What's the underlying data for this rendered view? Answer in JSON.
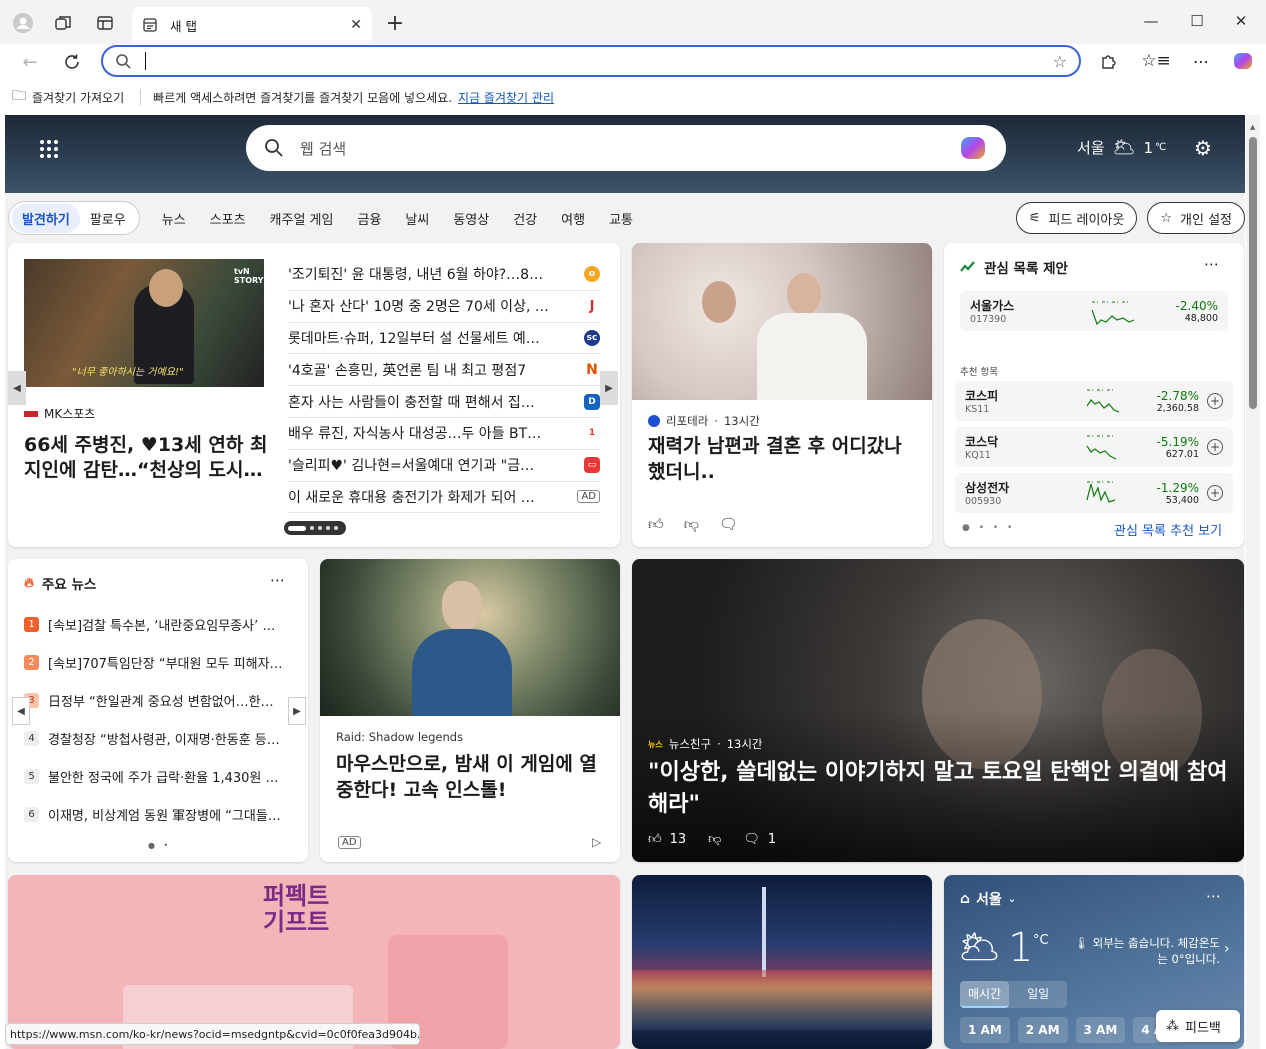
{
  "browser": {
    "tab_title": "새 탭",
    "favorites_import": "즐겨찾기 가져오기",
    "favorites_hint": "빠르게 액세스하려면 즐겨찾기를 즐겨찾기 모음에 넣으세요.",
    "favorites_manage": "지금 즐겨찾기 관리",
    "status_url": "https://www.msn.com/ko-kr/news?ocid=msedgntp&cvid=0c0f0fea3d904b...",
    "accent_color": "#3a63d8"
  },
  "hero": {
    "search_placeholder": "웹 검색",
    "city": "서울",
    "temp": "1",
    "temp_unit": "℃"
  },
  "nav": {
    "tabs": [
      "발견하기",
      "팔로우"
    ],
    "categories": [
      "뉴스",
      "스포츠",
      "캐주얼 게임",
      "금융",
      "날씨",
      "동영상",
      "건강",
      "여행",
      "교통"
    ],
    "feed_layout": "피드 레이아웃",
    "personalize": "개인 설정"
  },
  "carousel": {
    "source": "MK스포츠",
    "title": "66세 주병진, ♥13세 연하 최 지인에 감탄…“천상의 도시…",
    "image_caption": "\"너무 좋아하시는 거예요!\"",
    "image_logo": "tvN STORY",
    "headlines": [
      {
        "text": "'조기퇴진' 윤 대통령, 내년 6월 하야?…8…",
        "badge": "o",
        "badge_color": "#f5a623"
      },
      {
        "text": "'나 혼자 산다' 10명 중 2명은 70세 이상, …",
        "badge": "J",
        "badge_color": "#d32f2f"
      },
      {
        "text": "롯데마트·슈퍼, 12일부터 설 선물세트 예…",
        "badge": "sc",
        "badge_color": "#1e3a8a"
      },
      {
        "text": "'4호골' 손흥민, 英언론 팀 내 최고 평점7",
        "badge": "N",
        "badge_color": "#e65100"
      },
      {
        "text": "혼자 사는 사람들이 충전할 때 편해서 집…",
        "badge": "D",
        "badge_color": "#1565c0"
      },
      {
        "text": "배우 류진, 자식농사 대성공…두 아들 BT…",
        "badge": "1",
        "badge_color": "#e53935"
      },
      {
        "text": "'슬리피♥' 김나현=서울예대 연기과 \"금…",
        "badge": "▭",
        "badge_color": "#e53935"
      },
      {
        "text": "이 새로운 휴대용 충전기가 화제가 되어 …",
        "badge": "AD",
        "badge_color": "#ffffff"
      }
    ]
  },
  "feature": {
    "source": "리포테라",
    "age": "13시간",
    "title": "재력가 남편과 결혼 후 어디갔나 했더니.."
  },
  "watchlist": {
    "title": "관심 목록 제안",
    "stocks": [
      {
        "name": "서울가스",
        "code": "017390",
        "change": "-2.40%",
        "price": "48,800"
      }
    ],
    "recommended_label": "추천 항목",
    "recommended": [
      {
        "name": "코스피",
        "code": "KS11",
        "change": "-2.78%",
        "price": "2,360.58"
      },
      {
        "name": "코스닥",
        "code": "KQ11",
        "change": "-5.19%",
        "price": "627.01"
      },
      {
        "name": "삼성전자",
        "code": "005930",
        "change": "-1.29%",
        "price": "53,400"
      }
    ],
    "link": "관심 목록 추천 보기"
  },
  "top_news": {
    "title": "주요 뉴스",
    "items": [
      {
        "n": "1",
        "text": "[속보]검찰 특수본, ‘내란중요임무종사’ …"
      },
      {
        "n": "2",
        "text": "[속보]707특임단장 “부대원 모두 피해자…"
      },
      {
        "n": "3",
        "text": "日정부 “한일관계 중요성 변함없어…한…"
      },
      {
        "n": "4",
        "text": "경찰청장 “방첩사령관, 이재명·한동훈 등…"
      },
      {
        "n": "5",
        "text": "불안한 정국에 주가 급락·환율 1,430원 …"
      },
      {
        "n": "6",
        "text": "이재명, 비상계엄 동원 軍장병에 “그대들…"
      }
    ]
  },
  "ad_card": {
    "source": "Raid: Shadow legends",
    "title": "마우스만으로, 밤새 이 게임에 열중한다! 고속 인스톨!",
    "ad": "AD"
  },
  "big_story": {
    "source": "뉴스친구",
    "age": "13시간",
    "title": "\"이상한, 쓸데없는 이야기하지 말고 토요일 탄핵안 의결에 참여해라\"",
    "likes": "13",
    "comments": "1"
  },
  "promo": {
    "text_line1": "퍼펙트",
    "text_line2": "기프트"
  },
  "weather": {
    "city": "서울",
    "temp": "1",
    "unit": "°C",
    "desc": "외부는 춥습니다. 체감온도는 0°입니다.",
    "tabs": [
      "매시간",
      "일일"
    ],
    "hours": [
      "1 AM",
      "2 AM",
      "3 AM",
      "4 AM"
    ]
  },
  "feedback": "피드백"
}
